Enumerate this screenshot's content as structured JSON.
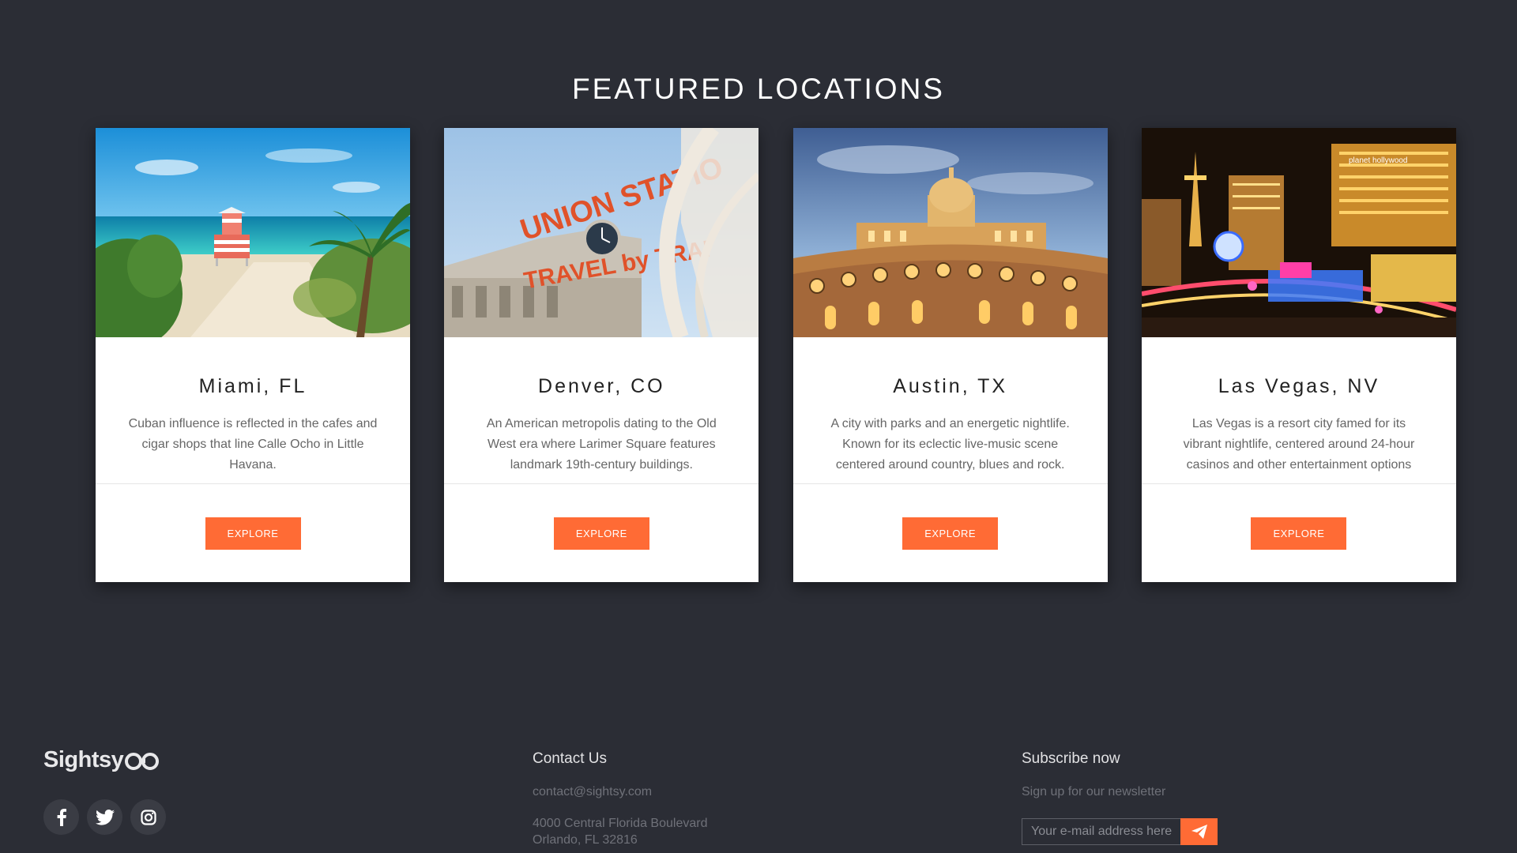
{
  "section": {
    "title": "FEATURED LOCATIONS"
  },
  "cards": [
    {
      "title": "Miami, FL",
      "description": "Cuban influence is reflected in the cafes and cigar shops that line Calle Ocho in Little Havana.",
      "button": "EXPLORE"
    },
    {
      "title": "Denver, CO",
      "description": "An American metropolis dating to the Old West era where Larimer Square features landmark 19th-century buildings.",
      "button": "EXPLORE",
      "sign_line1": "UNION STATIO",
      "sign_line2": "TRAVEL by TRAI"
    },
    {
      "title": "Austin, TX",
      "description": "A city with parks and an energetic nightlife. Known for its eclectic live-music scene centered around country, blues and rock.",
      "button": "EXPLORE"
    },
    {
      "title": "Las Vegas, NV",
      "description": "Las Vegas is a resort city famed for its vibrant nightlife, centered around 24-hour casinos and other entertainment options",
      "button": "EXPLORE",
      "sign_text": "planet hollywood"
    }
  ],
  "footer": {
    "logo": "Sightsy",
    "socials": [
      "facebook-icon",
      "twitter-icon",
      "instagram-icon"
    ],
    "contact": {
      "heading": "Contact Us",
      "email": "contact@sightsy.com",
      "address_line1": "4000 Central Florida Boulevard",
      "address_line2": "Orlando, FL 32816"
    },
    "subscribe": {
      "heading": "Subscribe now",
      "text": "Sign up for our newsletter",
      "placeholder": "Your e-mail address here"
    }
  },
  "colors": {
    "background": "#2b2d35",
    "accent": "#ff6b35",
    "card": "#ffffff"
  }
}
